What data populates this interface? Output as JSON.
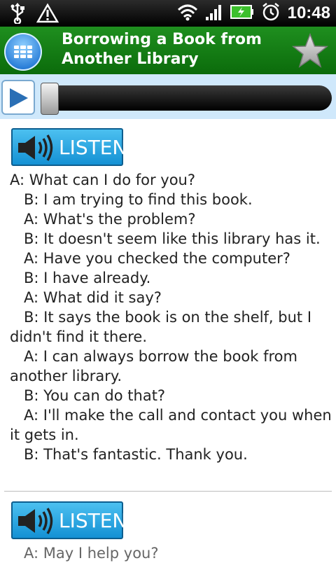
{
  "status_bar": {
    "time": "10:48",
    "icons": [
      "usb-icon",
      "warning-icon",
      "wifi-icon",
      "signal-icon",
      "battery-charging-icon",
      "alarm-icon"
    ]
  },
  "header": {
    "title_line1": "Borrowing a Book from",
    "title_line2": "Another Library",
    "accent": "#138a13"
  },
  "player": {
    "progress": 0.0
  },
  "lessons": [
    {
      "listen_label": "LISTEN",
      "lines": [
        "A: What can I do for you?",
        "B: I am trying to find this book.",
        "A: What's the problem?",
        "B: It doesn't seem like this library has it.",
        "A: Have you checked the computer?",
        "B: I have already.",
        "A: What did it say?",
        "B: It says the book is on the shelf, but I didn't find it there.",
        "A: I can always borrow the book from another library.",
        "B: You can do that?",
        "A: I'll make the call and contact you when it gets in.",
        "B: That's fantastic. Thank you."
      ]
    },
    {
      "listen_label": "LISTEN",
      "lines": [
        "A: May I help you?"
      ]
    }
  ]
}
